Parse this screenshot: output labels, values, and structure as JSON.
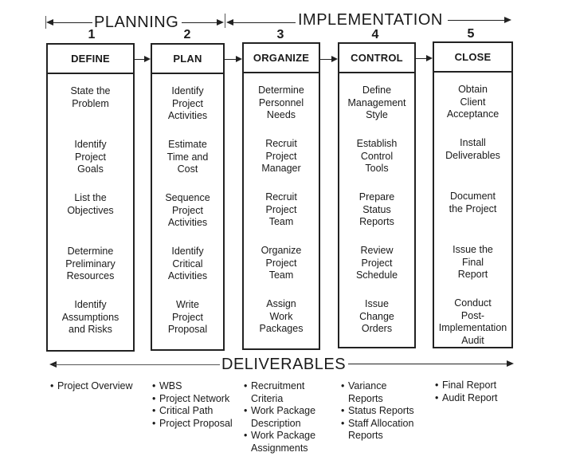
{
  "phases": {
    "planning": "PLANNING",
    "implementation": "IMPLEMENTATION",
    "deliverables": "DELIVERABLES"
  },
  "stages": [
    {
      "number": "1",
      "title": "DEFINE",
      "tasks": [
        "State the\nProblem",
        "Identify\nProject\nGoals",
        "List the\nObjectives",
        "Determine\nPreliminary\nResources",
        "Identify\nAssumptions\nand Risks"
      ]
    },
    {
      "number": "2",
      "title": "PLAN",
      "tasks": [
        "Identify\nProject\nActivities",
        "Estimate\nTime and\nCost",
        "Sequence\nProject\nActivities",
        "Identify\nCritical\nActivities",
        "Write\nProject\nProposal"
      ]
    },
    {
      "number": "3",
      "title": "ORGANIZE",
      "tasks": [
        "Determine\nPersonnel\nNeeds",
        "Recruit\nProject\nManager",
        "Recruit\nProject\nTeam",
        "Organize\nProject\nTeam",
        "Assign\nWork\nPackages"
      ]
    },
    {
      "number": "4",
      "title": "CONTROL",
      "tasks": [
        "Define\nManagement\nStyle",
        "Establish\nControl\nTools",
        "Prepare\nStatus\nReports",
        "Review\nProject\nSchedule",
        "Issue\nChange\nOrders"
      ]
    },
    {
      "number": "5",
      "title": "CLOSE",
      "tasks": [
        "Obtain\nClient\nAcceptance",
        "Install\nDeliverables",
        "Document\nthe Project",
        "Issue the\nFinal\nReport",
        "Conduct\nPost-\nImplementation\nAudit"
      ]
    }
  ],
  "deliverables": [
    [
      "Project Overview"
    ],
    [
      "WBS",
      "Project Network",
      "Critical Path",
      "Project Proposal"
    ],
    [
      "Recruitment\nCriteria",
      "Work Package\nDescription",
      "Work Package\nAssignments"
    ],
    [
      "Variance\nReports",
      "Status Reports",
      "Staff Allocation\nReports"
    ],
    [
      "Final Report",
      "Audit Report"
    ]
  ],
  "bullet_glyph": "•"
}
